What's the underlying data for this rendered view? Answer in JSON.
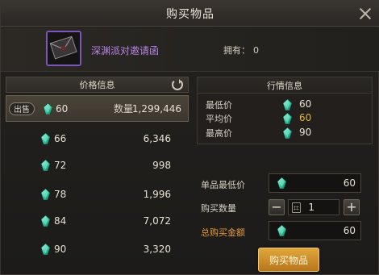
{
  "window": {
    "title": "购买物品"
  },
  "item": {
    "name": "深渊派对邀请函",
    "owned_label": "拥有：",
    "owned_count": "0"
  },
  "price_panel": {
    "header": "价格信息",
    "selected": {
      "tag": "出售",
      "price": "60",
      "qty_label": "数量",
      "qty": "1,299,446"
    },
    "rows": [
      {
        "price": "66",
        "qty": "6,346"
      },
      {
        "price": "72",
        "qty": "998"
      },
      {
        "price": "78",
        "qty": "1,996"
      },
      {
        "price": "84",
        "qty": "7,072"
      },
      {
        "price": "90",
        "qty": "3,320"
      }
    ]
  },
  "market": {
    "header": "行情信息",
    "min_label": "最低价",
    "min_value": "60",
    "avg_label": "平均价",
    "avg_value": "60",
    "max_label": "最高价",
    "max_value": "90"
  },
  "form": {
    "unit_min_label": "单品最低价",
    "unit_min_value": "60",
    "qty_label": "购买数量",
    "qty_value": "1",
    "total_label": "总购买金额",
    "total_value": "60"
  },
  "buy_button": "购买物品",
  "icons": [
    "close-icon",
    "refresh-icon",
    "gem-icon",
    "calculator-icon",
    "minus-icon",
    "plus-icon",
    "item-envelope-icon"
  ],
  "colors": {
    "accent_orange": "#e89a3c",
    "avg_yellow": "#e6b24a",
    "item_purple": "#b784e6",
    "button_gold": "#d39430"
  }
}
